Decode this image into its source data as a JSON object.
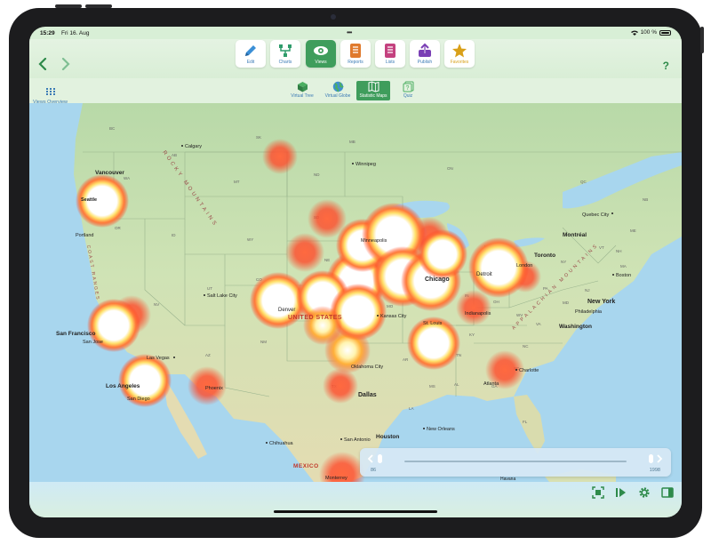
{
  "status": {
    "time": "15:29",
    "date": "Fri 16. Aug",
    "battery": "100 %"
  },
  "toolbar": {
    "back_icon": "chevron-left-icon",
    "forward_icon": "chevron-right-icon",
    "help_label": "?",
    "tools": [
      {
        "label": "Edit",
        "icon": "pencil-icon"
      },
      {
        "label": "Charts",
        "icon": "tree-chart-icon"
      },
      {
        "label": "Views",
        "icon": "eye-icon"
      },
      {
        "label": "Reports",
        "icon": "report-icon"
      },
      {
        "label": "Lists",
        "icon": "list-icon"
      },
      {
        "label": "Publish",
        "icon": "publish-icon"
      },
      {
        "label": "Favorites",
        "icon": "star-icon"
      }
    ],
    "active_tool": "Views"
  },
  "subbar": {
    "overview_label": "Views Overview",
    "items": [
      {
        "label": "Virtual Tree",
        "icon": "cube-icon"
      },
      {
        "label": "Virtual Globe",
        "icon": "globe-icon"
      },
      {
        "label": "Statistic Maps",
        "icon": "map-icon"
      },
      {
        "label": "Quiz",
        "icon": "quiz-icon"
      }
    ],
    "active_item": "Statistic Maps"
  },
  "map": {
    "cities": {
      "calgary": "Calgary",
      "vancouver": "Vancouver",
      "winnipeg": "Winnipeg",
      "seattle": "Seattle",
      "portland": "Portland",
      "minneapolis": "Minneapolis",
      "quebec": "Quebec City",
      "montreal": "Montréal",
      "toronto": "Toronto",
      "chicago": "Chicago",
      "detroit": "Detroit",
      "london": "London",
      "boston": "Boston",
      "saltlake": "Salt Lake City",
      "denver": "Denver",
      "newyork": "New York",
      "philadelphia": "Philadelphia",
      "washington": "Washington",
      "kansas": "Kansas City",
      "stlouis": "St. Louis",
      "indianapolis": "Indianapolis",
      "sanfrancisco": "San Francisco",
      "sanjose": "San Jose",
      "lasvegas": "Las Vegas",
      "oklahoma": "Oklahoma City",
      "losangeles": "Los Angeles",
      "sandiego": "San Diego",
      "phoenix": "Phoenix",
      "charlotte": "Charlotte",
      "atlanta": "Atlanta",
      "dallas": "Dallas",
      "chihuahua": "Chihuahua",
      "sanantonio": "San Antonio",
      "houston": "Houston",
      "neworleans": "New Orleans",
      "monterrey": "Monterrey",
      "havana": "Havana"
    },
    "regions": {
      "unitedstates": "UNITED STATES",
      "mexico": "MEXICO",
      "rocky": "ROCKY MOUNTAINS",
      "appalachian": "APPALACHIAN MOUNTAINS",
      "coast": "COAST RANGES"
    },
    "states": [
      "WA",
      "OR",
      "ID",
      "MT",
      "ND",
      "SD",
      "WY",
      "NE",
      "UT",
      "CO",
      "KS",
      "OK",
      "TX",
      "NM",
      "AZ",
      "NV",
      "CA",
      "IA",
      "MO",
      "IL",
      "WI",
      "MI",
      "IN",
      "OH",
      "KY",
      "TN",
      "AR",
      "MS",
      "AL",
      "GA",
      "SC",
      "NC",
      "VA",
      "WV",
      "PA",
      "NY",
      "ME",
      "NH",
      "VT",
      "MA",
      "NJ",
      "MD",
      "LA",
      "FL",
      "SK",
      "MB",
      "ON",
      "AB",
      "QC",
      "NB",
      "BC"
    ],
    "heat_color_hot": "#ffffff",
    "heat_color_mid": "#ffd84a",
    "heat_color_cool": "#ff3a1a"
  },
  "timeline": {
    "start_label": "86",
    "end_label": "1998",
    "position": 1.0
  },
  "bottom_icons": [
    "fit-screen-icon",
    "play-step-icon",
    "gear-icon",
    "sidebar-icon"
  ]
}
